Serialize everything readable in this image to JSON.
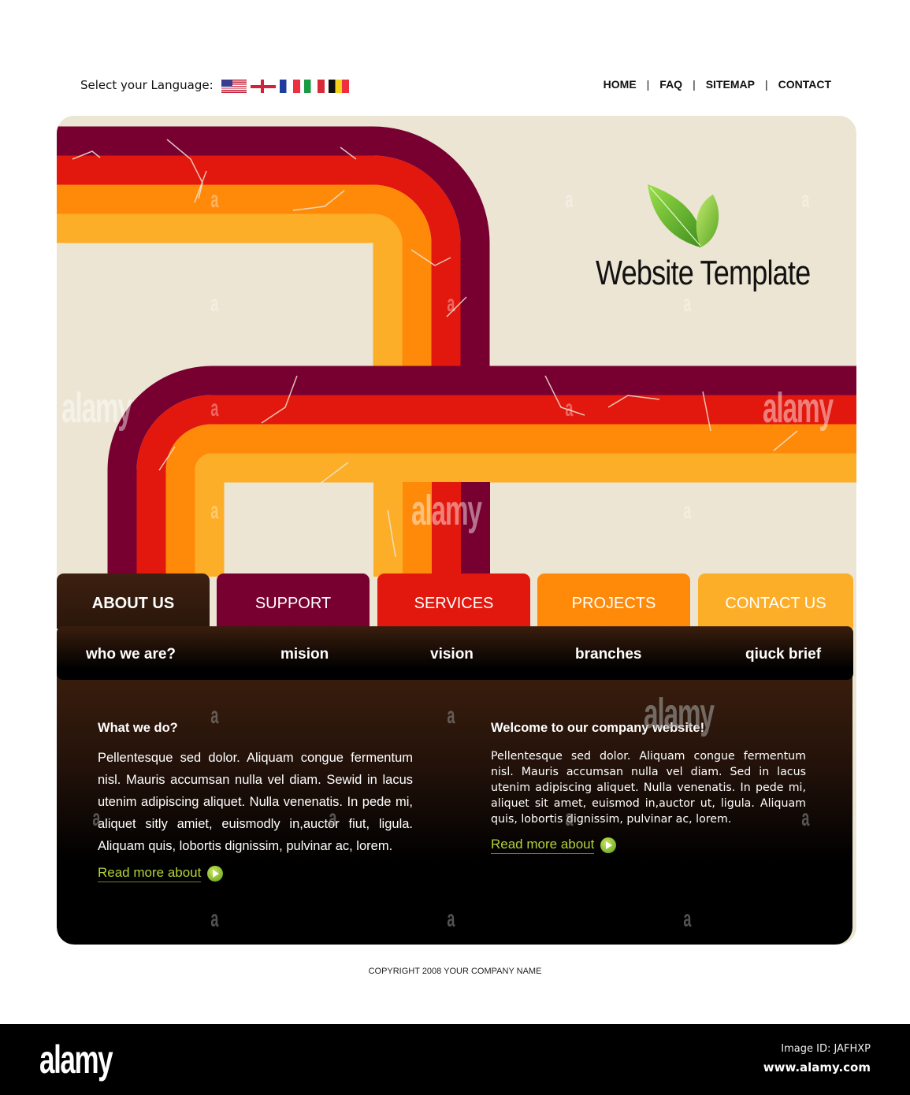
{
  "header": {
    "language_label": "Select your Language:",
    "flags": [
      {
        "name": "us-flag-icon",
        "lang": "English (US)"
      },
      {
        "name": "england-flag-icon",
        "lang": "English (UK)"
      },
      {
        "name": "france-flag-icon",
        "lang": "French"
      },
      {
        "name": "italy-flag-icon",
        "lang": "Italian"
      },
      {
        "name": "belgium-flag-icon",
        "lang": "Belgian"
      }
    ],
    "nav": [
      "HOME",
      "FAQ",
      "SITEMAP",
      "CONTACT"
    ],
    "nav_separator": "|"
  },
  "brand": {
    "title": "Website Template",
    "logo_icon": "leaf-icon",
    "colors": {
      "leaf": "#6fbf2a",
      "panel_bg": "#ece5d3"
    }
  },
  "stripes": {
    "colors": [
      "#780030",
      "#e2170d",
      "#ff8a0a",
      "#fdae28"
    ]
  },
  "tabs": [
    {
      "label": "ABOUT US",
      "color": "#3a1d0d",
      "active": true
    },
    {
      "label": "SUPPORT",
      "color": "#780030",
      "active": false
    },
    {
      "label": "SERVICES",
      "color": "#e2170d",
      "active": false
    },
    {
      "label": "PROJECTS",
      "color": "#ff8a0a",
      "active": false
    },
    {
      "label": "CONTACT US",
      "color": "#fdae28",
      "active": false
    }
  ],
  "subnav": [
    "who we are?",
    "mision",
    "vision",
    "branches",
    "qiuck brief"
  ],
  "content": {
    "left": {
      "heading": "What we do?",
      "body": "Pellentesque sed dolor. Aliquam congue fermentum nisl. Mauris accumsan nulla vel diam. Sewid in lacus utenim adipiscing aliquet. Nulla venenatis. In pede mi, aliquet sitly amiet, euismodly in,auctor fiut, ligula. Aliquam quis, lobortis dignissim, pulvinar ac, lorem.",
      "link": "Read more about",
      "link_icon": "play-arrow-icon"
    },
    "right": {
      "heading": "Welcome to our company website!",
      "body": "Pellentesque sed dolor. Aliquam congue fermentum nisl. Mauris accumsan nulla vel diam. Sed in lacus utenim adipiscing aliquet. Nulla venenatis. In pede mi, aliquet sit amet, euismod in,auctor ut, ligula. Aliquam quis, lobortis dignissim, pulvinar ac, lorem.",
      "link": "Read more about",
      "link_icon": "play-arrow-icon"
    },
    "link_color": "#b3d23a"
  },
  "copyright": "COPYRIGHT 2008 YOUR COMPANY NAME",
  "watermark": {
    "word": "alamy",
    "letter": "a",
    "image_id": "Image ID: JAFHXP",
    "url": "www.alamy.com"
  }
}
